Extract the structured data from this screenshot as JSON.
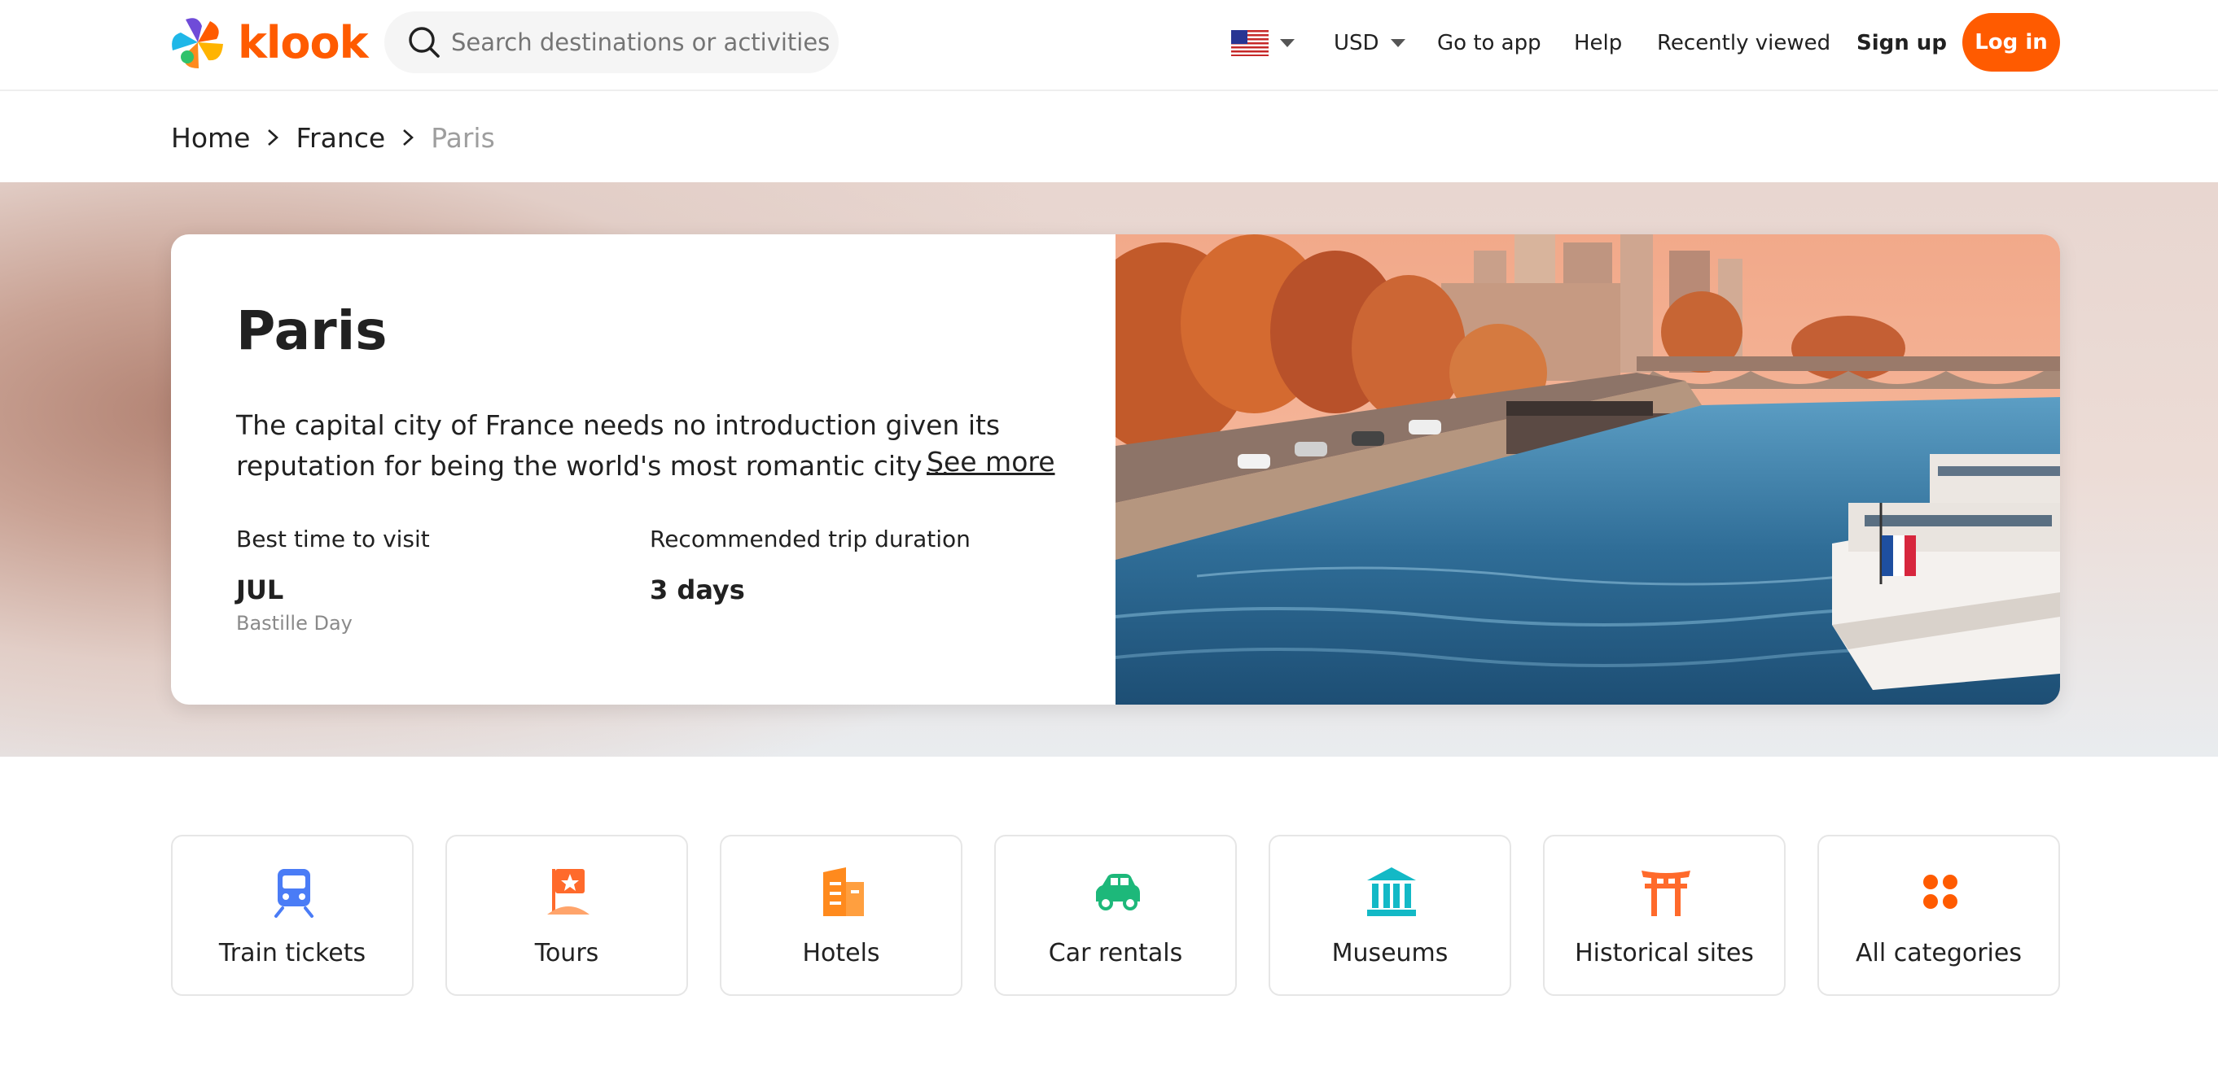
{
  "header": {
    "brand": "klook",
    "search_placeholder": "Search destinations or activities",
    "locale_flag": "us-flag-icon",
    "currency": "USD",
    "nav": {
      "go_to_app": "Go to app",
      "help": "Help",
      "recently_viewed": "Recently viewed",
      "sign_up": "Sign up",
      "log_in": "Log in"
    },
    "accent_color": "#ff5b00"
  },
  "breadcrumb": {
    "items": [
      "Home",
      "France",
      "Paris"
    ]
  },
  "destination": {
    "title": "Paris",
    "description_line1": "The capital city of France needs no introduction given its",
    "description_line2": "reputation for being the world's most romantic city",
    "ellipsis": "...",
    "see_more": "See more",
    "best_time_label": "Best time to visit",
    "best_time_value": "JUL",
    "best_time_note": "Bastille Day",
    "duration_label": "Recommended trip duration",
    "duration_value": "3 days",
    "image": "paris-seine-river-boats-photo"
  },
  "categories": [
    {
      "label": "Train tickets",
      "icon": "train-icon",
      "color": "#4a7cf6"
    },
    {
      "label": "Tours",
      "icon": "flag-icon",
      "color": "#ff6a2b"
    },
    {
      "label": "Hotels",
      "icon": "hotel-icon",
      "color": "#ff8a1d"
    },
    {
      "label": "Car rentals",
      "icon": "car-icon",
      "color": "#1db87a"
    },
    {
      "label": "Museums",
      "icon": "museum-icon",
      "color": "#13b9c6"
    },
    {
      "label": "Historical sites",
      "icon": "torii-gate-icon",
      "color": "#ff6a2b"
    },
    {
      "label": "All categories",
      "icon": "grid-dots-icon",
      "color": "#ff5b00"
    }
  ]
}
